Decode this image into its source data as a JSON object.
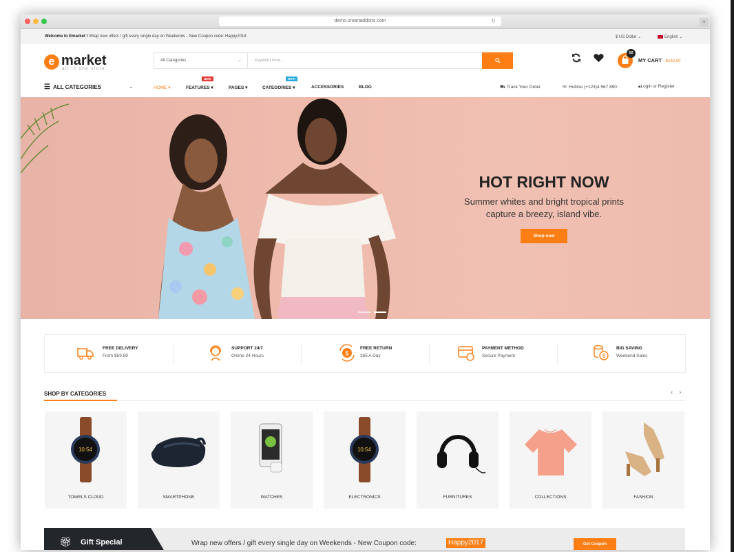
{
  "browser": {
    "url": "demo.smartaddons.com"
  },
  "topbar": {
    "welcome_bold": "Welcome to Emarket !",
    "welcome_text": " Wrap new offers / gift every single day on Weekends - New Coupon code: Happy2018",
    "currency": "$ US Dollar ⌄",
    "language": "English ⌄"
  },
  "header": {
    "logo_word": "market",
    "logo_letter": "e",
    "logo_tagline": "all in one store",
    "category_select": "All Categories",
    "search_placeholder": "Keyword here...",
    "cart_count": "02",
    "cart_label": "MY CART",
    "cart_price": "- $162.00"
  },
  "nav": {
    "all_categories": "ALL CATEGORIES",
    "items": [
      {
        "label": "HOME ▾",
        "badge": ""
      },
      {
        "label": "FEATURES ▾",
        "badge": "NEW"
      },
      {
        "label": "PAGES ▾",
        "badge": ""
      },
      {
        "label": "CATEGORIES ▾",
        "badge": "HOT!"
      },
      {
        "label": "ACCESSORIES",
        "badge": ""
      },
      {
        "label": "BLOG",
        "badge": ""
      }
    ],
    "track_order": "Track Your Order",
    "hotline": "Hotline (+123)4 567 890",
    "login": "Login or Register"
  },
  "hero": {
    "title": "HOT RIGHT NOW",
    "subtitle_line1": "Summer whites and bright tropical prints",
    "subtitle_line2": "capture a breezy, island vibe.",
    "button": "Shop now"
  },
  "features": [
    {
      "title": "FREE DELIVERY",
      "sub": "From $59.89",
      "icon": "truck-icon"
    },
    {
      "title": "SUPPORT 24/7",
      "sub": "Online 24 Hours",
      "icon": "headset-icon"
    },
    {
      "title": "FREE RETURN",
      "sub": "365 A Day",
      "icon": "return-icon"
    },
    {
      "title": "PAYMENT METHOD",
      "sub": "Secure Payment",
      "icon": "card-icon"
    },
    {
      "title": "BIG SAVING",
      "sub": "Weekend Sales",
      "icon": "coins-icon"
    }
  ],
  "categories": {
    "title": "SHOP BY CATEGORIES",
    "arrows": "‹ ›",
    "items": [
      {
        "label": "TOWELS CLOUD",
        "image": "smartwatch"
      },
      {
        "label": "SMARTPHONE",
        "image": "vr-headset"
      },
      {
        "label": "WATCHES",
        "image": "phone-tracker"
      },
      {
        "label": "ELECTRONICS",
        "image": "smartwatch"
      },
      {
        "label": "FURNITURES",
        "image": "headphones"
      },
      {
        "label": "COLLECTIONS",
        "image": "blouse"
      },
      {
        "label": "FASHION",
        "image": "sandals"
      }
    ]
  },
  "gift": {
    "title": "Gift Special",
    "text": "Wrap new offers / gift every single day on Weekends - New Coupon code:",
    "code": "Happy2017",
    "button": "Get Coupon"
  },
  "colors": {
    "accent": "#fd7e14",
    "dark": "#23262b",
    "hero_bg": "#eebaac"
  }
}
